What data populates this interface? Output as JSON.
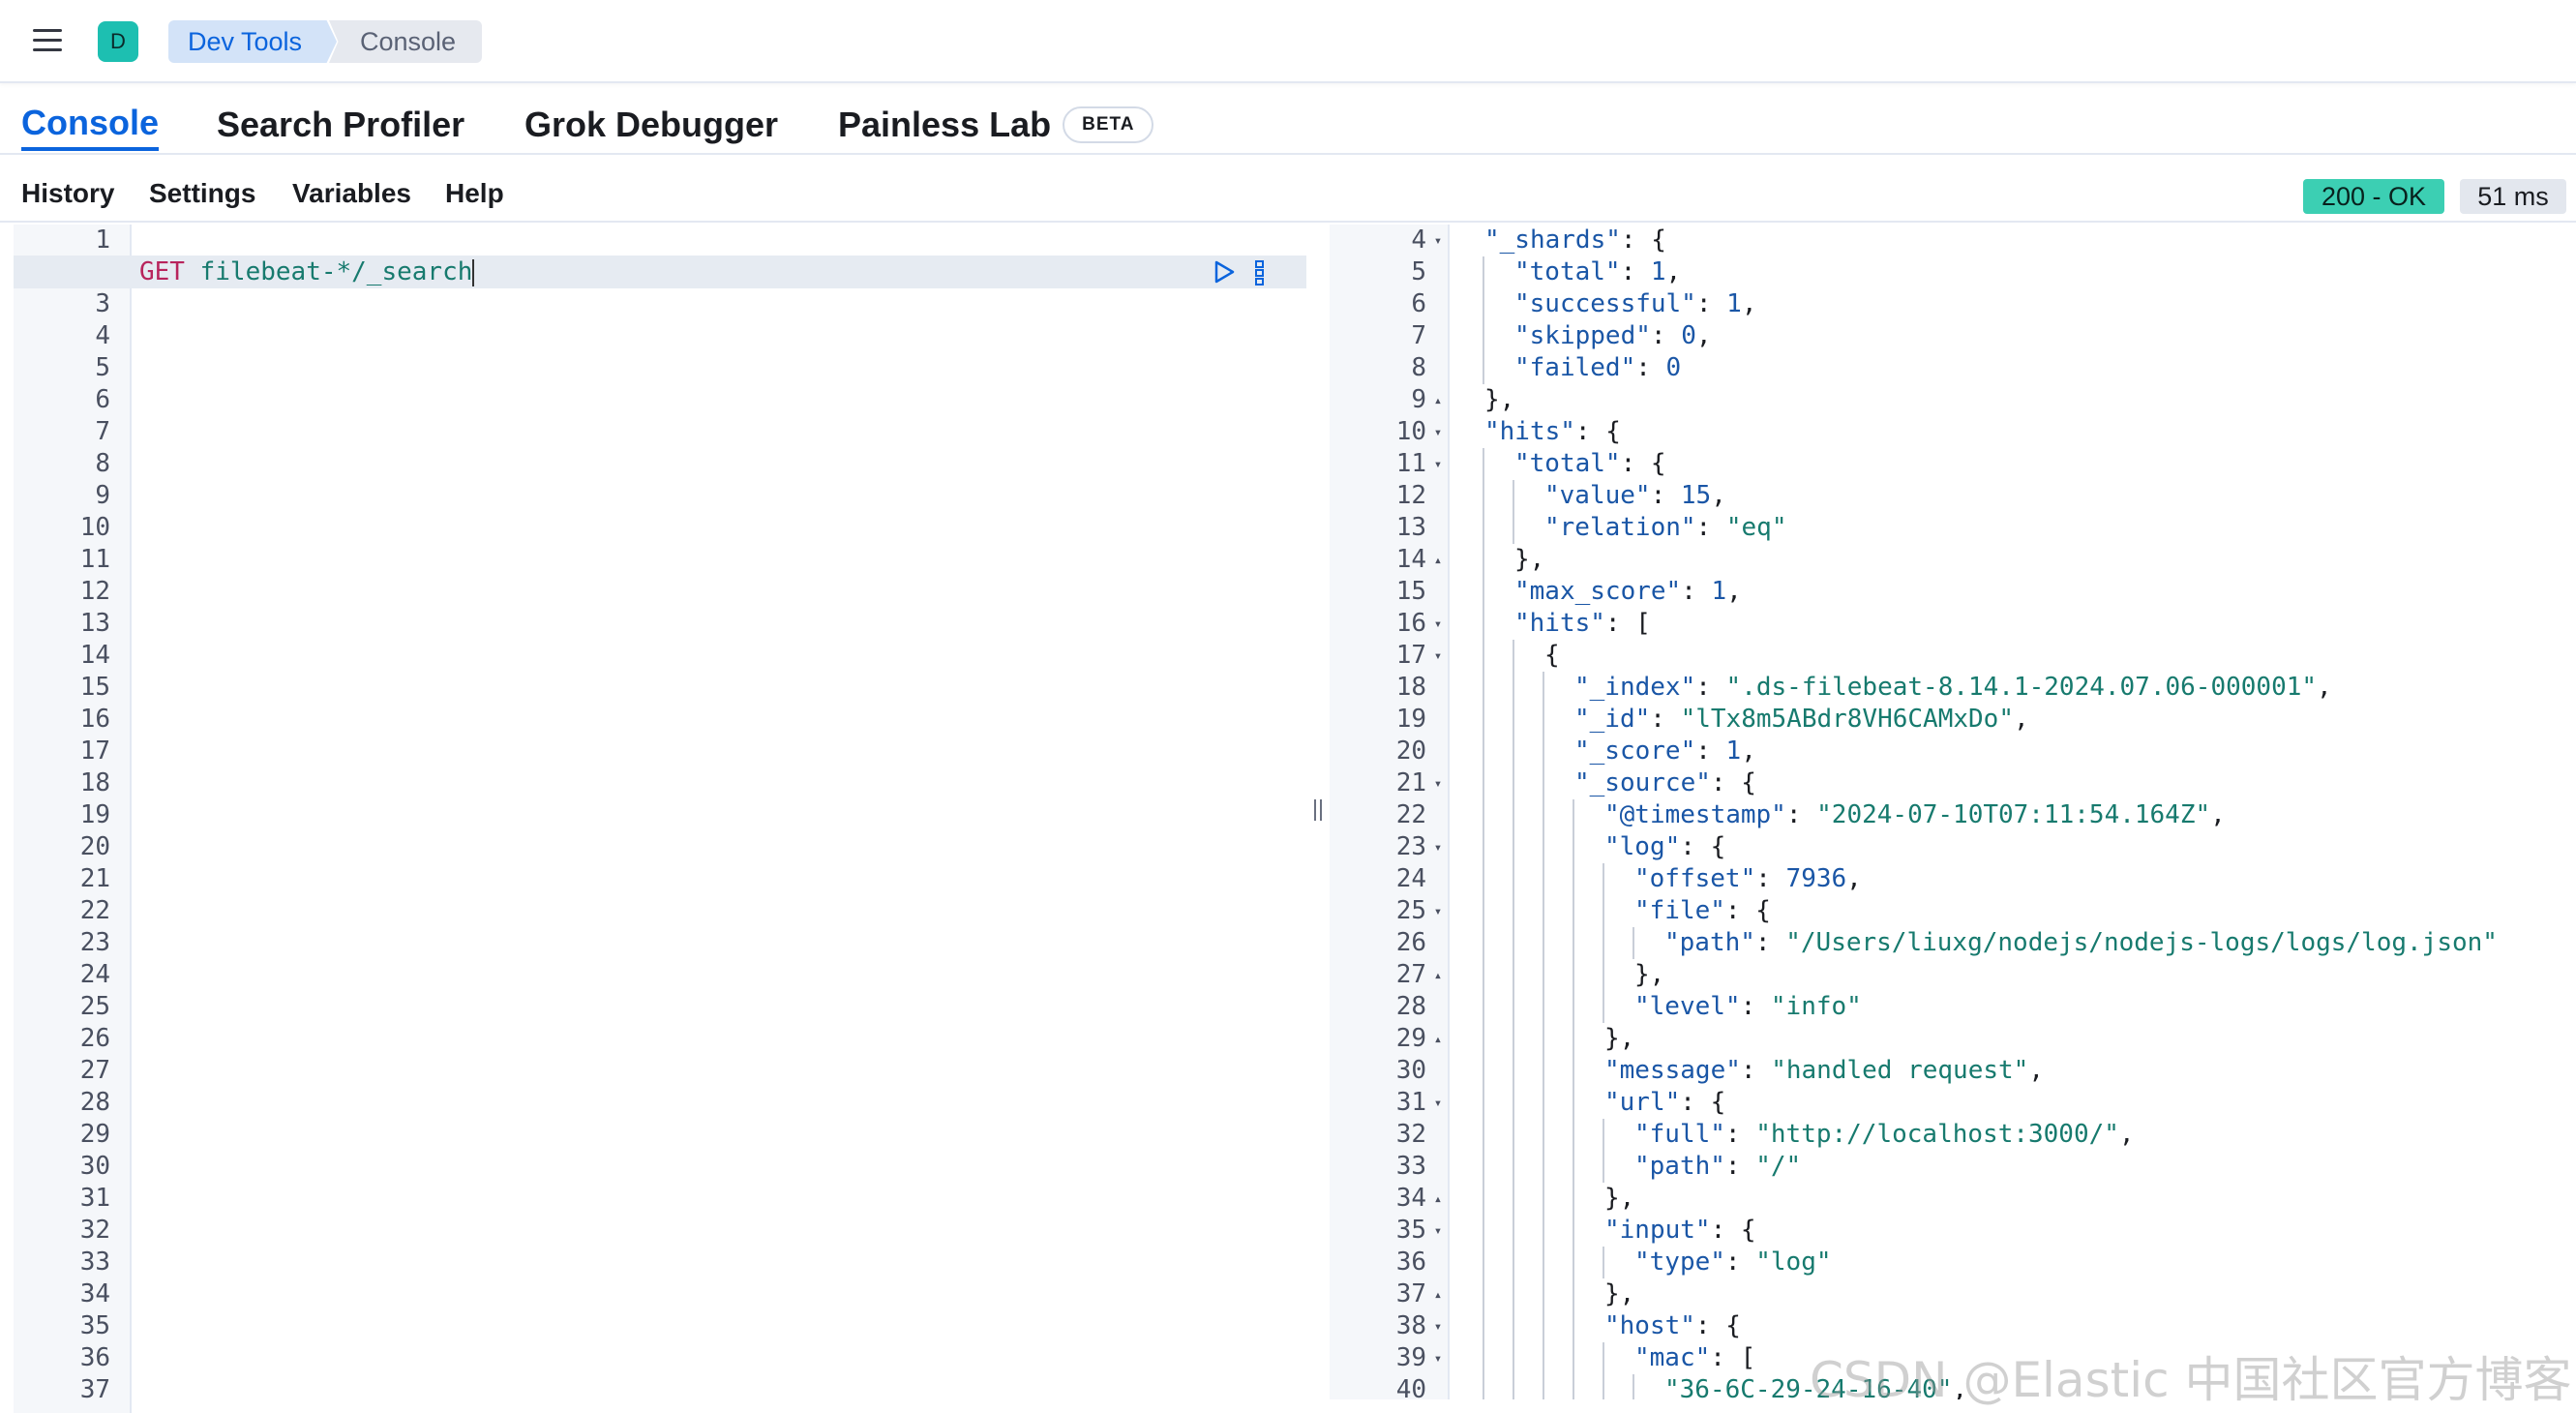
{
  "header": {
    "space_initial": "D",
    "breadcrumbs": [
      "Dev Tools",
      "Console"
    ]
  },
  "tabs": [
    {
      "label": "Console",
      "active": true
    },
    {
      "label": "Search Profiler",
      "active": false
    },
    {
      "label": "Grok Debugger",
      "active": false
    },
    {
      "label": "Painless Lab",
      "active": false,
      "badge": "BETA"
    }
  ],
  "toolbar": {
    "items": [
      "History",
      "Settings",
      "Variables",
      "Help"
    ],
    "status_code": "200 - OK",
    "duration": "51 ms"
  },
  "request": {
    "method": "GET",
    "path": " filebeat-*/_search",
    "line_count": 37,
    "active_line": 2
  },
  "response": {
    "lines": [
      {
        "n": 4,
        "fold": "down",
        "depth": 0,
        "text": "\"_shards\": {"
      },
      {
        "n": 5,
        "depth": 1,
        "text": "\"total\": 1,"
      },
      {
        "n": 6,
        "depth": 1,
        "text": "\"successful\": 1,"
      },
      {
        "n": 7,
        "depth": 1,
        "text": "\"skipped\": 0,"
      },
      {
        "n": 8,
        "depth": 1,
        "text": "\"failed\": 0"
      },
      {
        "n": 9,
        "fold": "up",
        "depth": 0,
        "text": "},"
      },
      {
        "n": 10,
        "fold": "down",
        "depth": 0,
        "text": "\"hits\": {"
      },
      {
        "n": 11,
        "fold": "down",
        "depth": 1,
        "text": "\"total\": {"
      },
      {
        "n": 12,
        "depth": 2,
        "text": "\"value\": 15,"
      },
      {
        "n": 13,
        "depth": 2,
        "text": "\"relation\": \"eq\""
      },
      {
        "n": 14,
        "fold": "up",
        "depth": 1,
        "text": "},"
      },
      {
        "n": 15,
        "depth": 1,
        "text": "\"max_score\": 1,"
      },
      {
        "n": 16,
        "fold": "down",
        "depth": 1,
        "text": "\"hits\": ["
      },
      {
        "n": 17,
        "fold": "down",
        "depth": 2,
        "text": "{"
      },
      {
        "n": 18,
        "depth": 3,
        "text": "\"_index\": \".ds-filebeat-8.14.1-2024.07.06-000001\","
      },
      {
        "n": 19,
        "depth": 3,
        "text": "\"_id\": \"lTx8m5ABdr8VH6CAMxDo\","
      },
      {
        "n": 20,
        "depth": 3,
        "text": "\"_score\": 1,"
      },
      {
        "n": 21,
        "fold": "down",
        "depth": 3,
        "text": "\"_source\": {"
      },
      {
        "n": 22,
        "depth": 4,
        "text": "\"@timestamp\": \"2024-07-10T07:11:54.164Z\","
      },
      {
        "n": 23,
        "fold": "down",
        "depth": 4,
        "text": "\"log\": {"
      },
      {
        "n": 24,
        "depth": 5,
        "text": "\"offset\": 7936,"
      },
      {
        "n": 25,
        "fold": "down",
        "depth": 5,
        "text": "\"file\": {"
      },
      {
        "n": 26,
        "depth": 6,
        "text": "\"path\": \"/Users/liuxg/nodejs/nodejs-logs/logs/log.json\""
      },
      {
        "n": 27,
        "fold": "up",
        "depth": 5,
        "text": "},"
      },
      {
        "n": 28,
        "depth": 5,
        "text": "\"level\": \"info\""
      },
      {
        "n": 29,
        "fold": "up",
        "depth": 4,
        "text": "},"
      },
      {
        "n": 30,
        "depth": 4,
        "text": "\"message\": \"handled request\","
      },
      {
        "n": 31,
        "fold": "down",
        "depth": 4,
        "text": "\"url\": {"
      },
      {
        "n": 32,
        "depth": 5,
        "text": "\"full\": \"http://localhost:3000/\","
      },
      {
        "n": 33,
        "depth": 5,
        "text": "\"path\": \"/\""
      },
      {
        "n": 34,
        "fold": "up",
        "depth": 4,
        "text": "},"
      },
      {
        "n": 35,
        "fold": "down",
        "depth": 4,
        "text": "\"input\": {"
      },
      {
        "n": 36,
        "depth": 5,
        "text": "\"type\": \"log\""
      },
      {
        "n": 37,
        "fold": "up",
        "depth": 4,
        "text": "},"
      },
      {
        "n": 38,
        "fold": "down",
        "depth": 4,
        "text": "\"host\": {"
      },
      {
        "n": 39,
        "fold": "down",
        "depth": 5,
        "text": "\"mac\": ["
      },
      {
        "n": 40,
        "depth": 6,
        "text": "\"36-6C-29-24-16-40\","
      }
    ]
  },
  "watermark": "CSDN @Elastic 中国社区官方博客",
  "colors": {
    "accent": "#0b64dd",
    "ok": "#3ccfb3",
    "method": "#b8245c",
    "string": "#177a6e"
  }
}
